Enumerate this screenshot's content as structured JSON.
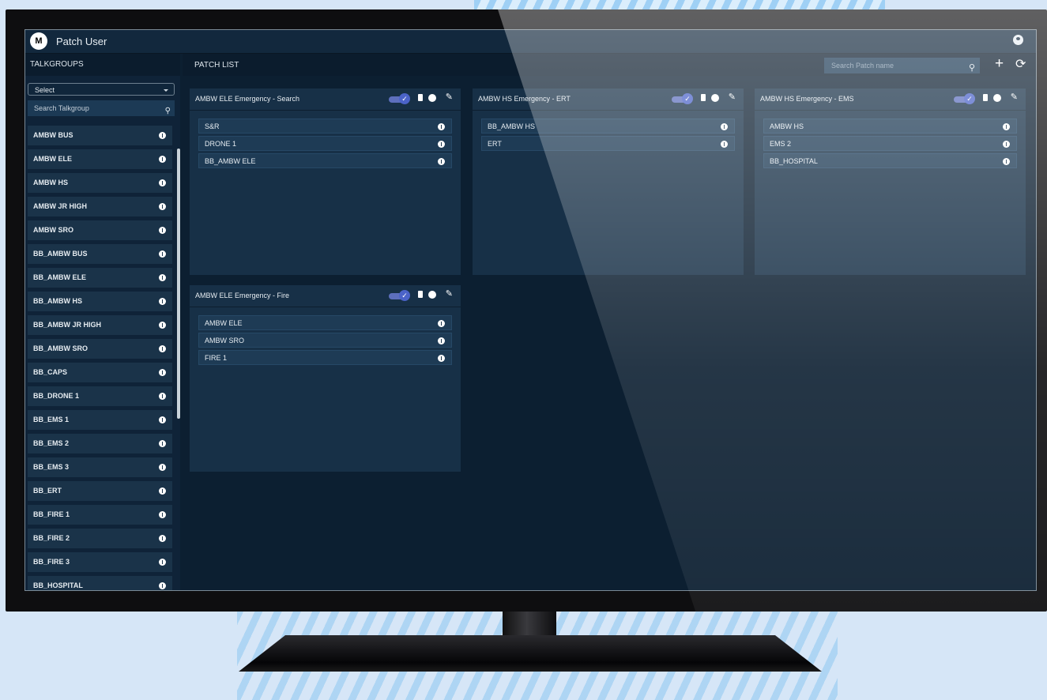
{
  "app": {
    "title": "Patch User",
    "logo_text": "M",
    "logo_icon": "motorola-logo-icon",
    "user_icon": "user-circle-icon"
  },
  "sidebar": {
    "heading": "TALKGROUPS",
    "select_value": "Select",
    "search_placeholder": "Search Talkgroup",
    "items": [
      {
        "label": "AMBW BUS"
      },
      {
        "label": "AMBW ELE"
      },
      {
        "label": "AMBW HS"
      },
      {
        "label": "AMBW JR HIGH"
      },
      {
        "label": "AMBW SRO"
      },
      {
        "label": "BB_AMBW BUS"
      },
      {
        "label": "BB_AMBW ELE"
      },
      {
        "label": "BB_AMBW HS"
      },
      {
        "label": "BB_AMBW JR HIGH"
      },
      {
        "label": "BB_AMBW SRO"
      },
      {
        "label": "BB_CAPS"
      },
      {
        "label": "BB_DRONE 1"
      },
      {
        "label": "BB_EMS 1"
      },
      {
        "label": "BB_EMS 2"
      },
      {
        "label": "BB_EMS 3"
      },
      {
        "label": "BB_ERT"
      },
      {
        "label": "BB_FIRE 1"
      },
      {
        "label": "BB_FIRE 2"
      },
      {
        "label": "BB_FIRE 3"
      },
      {
        "label": "BB_HOSPITAL"
      }
    ]
  },
  "patch_list": {
    "heading": "PATCH LIST",
    "search_placeholder": "Search Patch name",
    "add_label": "+",
    "refresh_label": "⟳",
    "cards": [
      {
        "title": "AMBW ELE Emergency - Search",
        "enabled": true,
        "members": [
          "S&R",
          "DRONE 1",
          "BB_AMBW ELE"
        ]
      },
      {
        "title": "AMBW HS Emergency - ERT",
        "enabled": true,
        "members": [
          "BB_AMBW HS",
          "ERT"
        ]
      },
      {
        "title": "AMBW HS Emergency - EMS",
        "enabled": true,
        "members": [
          "AMBW HS",
          "EMS 2",
          "BB_HOSPITAL"
        ]
      },
      {
        "title": "AMBW ELE Emergency - Fire",
        "enabled": true,
        "members": [
          "AMBW ELE",
          "AMBW SRO",
          "FIRE 1"
        ]
      }
    ]
  },
  "icons": {
    "search": "search-icon",
    "info": "info-icon",
    "trash": "trash-icon",
    "edit": "pencil-icon",
    "toggle": "toggle-icon"
  },
  "colors": {
    "background": "#d6e6f7",
    "screen": "#0c1f31",
    "panel": "#173047",
    "accent": "#5d6fbd"
  }
}
